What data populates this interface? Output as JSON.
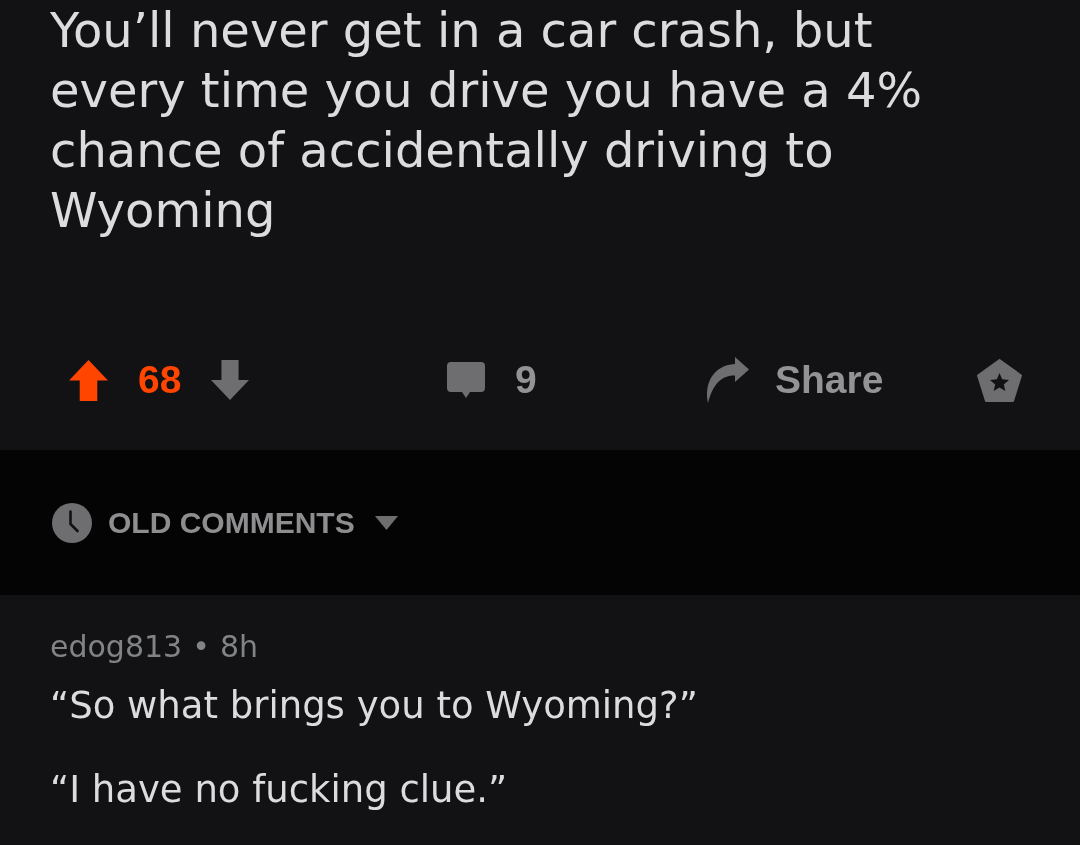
{
  "post": {
    "title": "You’ll never get in a car crash, but every time you drive you have a 4% chance of accidentally driving to Wyoming",
    "vote": {
      "upvoted": true,
      "downvoted": false,
      "score": "68"
    },
    "comments_count": "9",
    "share_label": "Share"
  },
  "sort": {
    "label": "OLD COMMENTS"
  },
  "comments": [
    {
      "author": "edog813",
      "separator": "•",
      "age": "8h",
      "paragraphs": [
        "“So what brings you to Wyoming?”",
        "“I have no fucking clue.”"
      ]
    }
  ]
}
